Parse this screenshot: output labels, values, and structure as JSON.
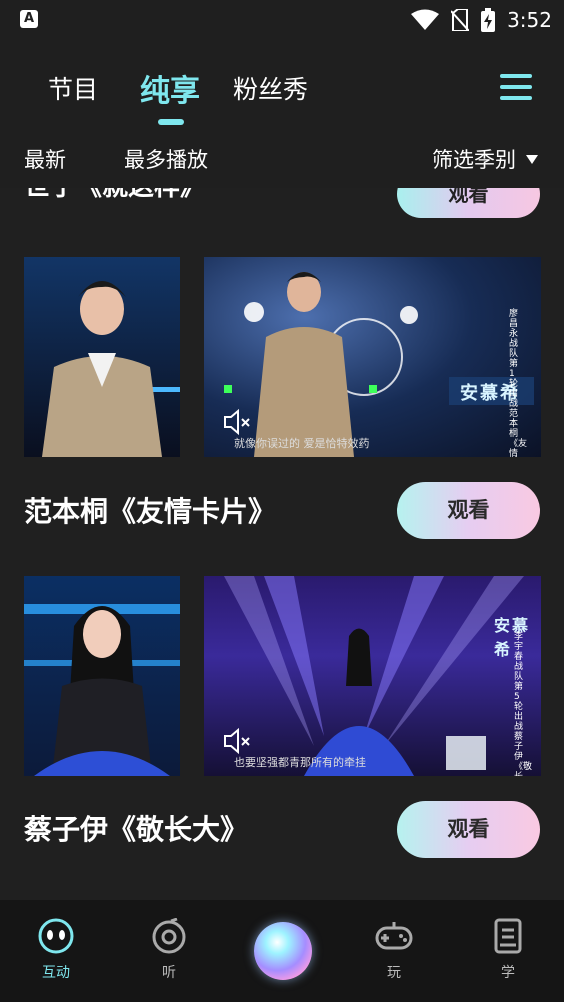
{
  "status_bar": {
    "time": "3:52",
    "app_icon": "A"
  },
  "top_tabs": [
    {
      "label": "节目"
    },
    {
      "label": "纯享"
    },
    {
      "label": "粉丝秀"
    }
  ],
  "filters": {
    "latest": "最新",
    "most_played": "最多播放",
    "season": "筛选季别"
  },
  "partial_item": {
    "title": "世子《就这样》",
    "watch_label": "观看"
  },
  "items": [
    {
      "title": "范本桐《友情卡片》",
      "watch_label": "观看",
      "video_subtitle": "就像你误过的 爱是恰特效药",
      "side_caption": "廖昌永战队第1轮出战范本桐《友情卡片》",
      "badge": "安慕希"
    },
    {
      "title": "蔡子伊《敬长大》",
      "watch_label": "观看",
      "video_subtitle": "也要坚强都青那所有的牵挂",
      "side_caption": "李宇春战队第5轮出战蔡子伊《敬长大》",
      "badge": "安慕希"
    }
  ],
  "bottom_nav": [
    {
      "label": "互动",
      "icon": "face-icon",
      "active": true
    },
    {
      "label": "听",
      "icon": "music-disc-icon"
    },
    {
      "label": "",
      "icon": "orb-icon"
    },
    {
      "label": "玩",
      "icon": "gamepad-icon"
    },
    {
      "label": "学",
      "icon": "book-icon"
    }
  ],
  "colors": {
    "accent": "#7fe7ee",
    "background": "#1f1f1f",
    "button_gradient": [
      "#b6f2ef",
      "#f9c9e2"
    ]
  }
}
